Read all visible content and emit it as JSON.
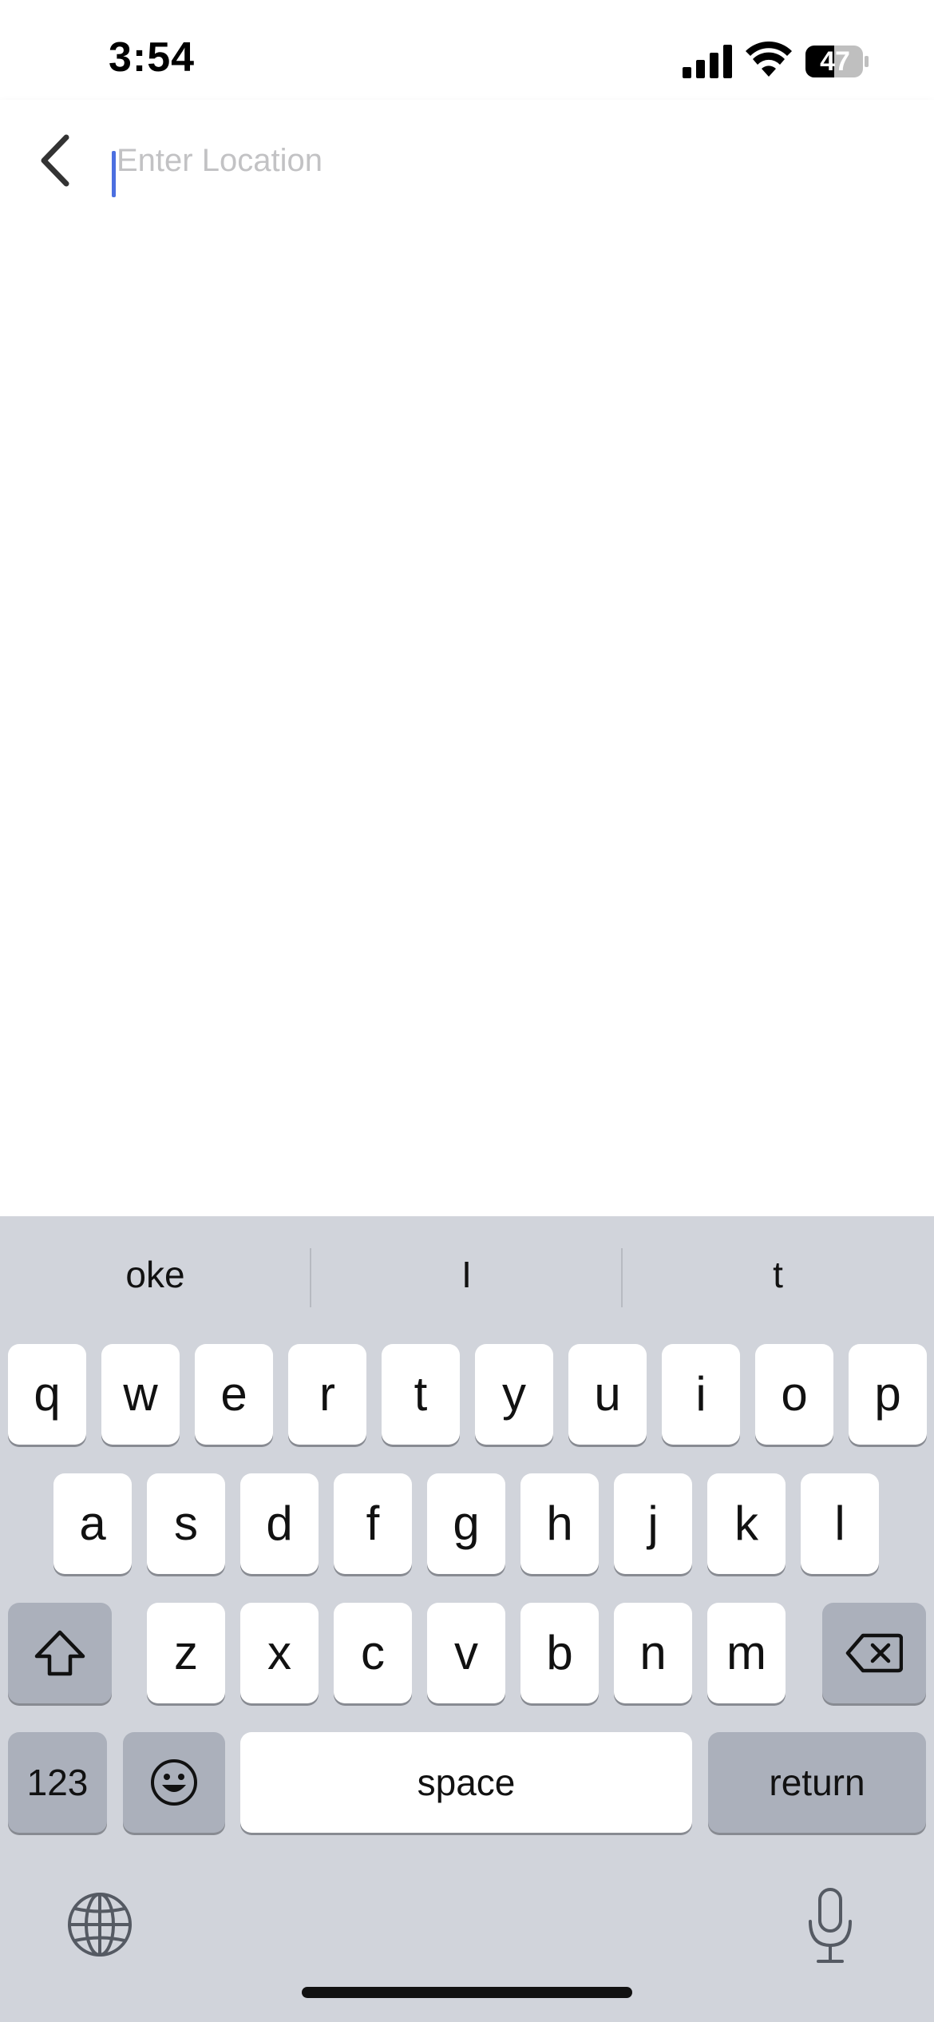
{
  "status_bar": {
    "time": "3:54",
    "battery_level": "47",
    "icons": [
      "cellular-signal-icon",
      "wifi-icon",
      "battery-icon"
    ]
  },
  "header": {
    "back_icon": "chevron-left-icon",
    "location_input": {
      "value": "",
      "placeholder": "Enter Location"
    }
  },
  "keyboard": {
    "suggestions": [
      "oke",
      "I",
      "t"
    ],
    "row1": [
      "q",
      "w",
      "e",
      "r",
      "t",
      "y",
      "u",
      "i",
      "o",
      "p"
    ],
    "row2": [
      "a",
      "s",
      "d",
      "f",
      "g",
      "h",
      "j",
      "k",
      "l"
    ],
    "row3": [
      "z",
      "x",
      "c",
      "v",
      "b",
      "n",
      "m"
    ],
    "row3_icons": {
      "shift": "shift-icon",
      "delete": "delete-icon"
    },
    "bottom": {
      "numbers": "123",
      "space": "space",
      "return": "return",
      "emoji_icon": "emoji-icon"
    },
    "extras": {
      "globe_icon": "globe-icon",
      "mic_icon": "microphone-icon"
    }
  },
  "colors": {
    "accent": "#4c6fe0",
    "keyboard_bg": "#d1d4db",
    "key_dark": "#abb0bb",
    "placeholder": "#c2c2c4"
  }
}
